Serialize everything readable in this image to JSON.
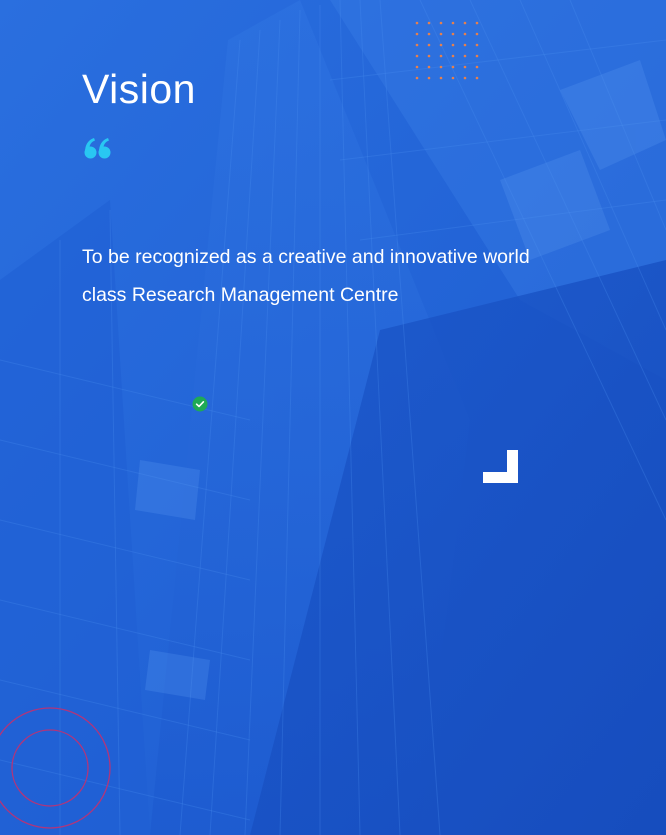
{
  "vision": {
    "title": "Vision",
    "statement": "To be recognized as a creative and innovative world class Research Management Centre"
  },
  "icons": {
    "quote": "quote-icon",
    "check": "check-icon",
    "corner": "corner-mark-icon"
  },
  "colors": {
    "background": "#2466d8",
    "quote_accent": "#29c7f2",
    "dot_accent": "#e8804c",
    "check_green": "#1faa55",
    "circle_accent": "#b2357a",
    "text": "#ffffff"
  }
}
